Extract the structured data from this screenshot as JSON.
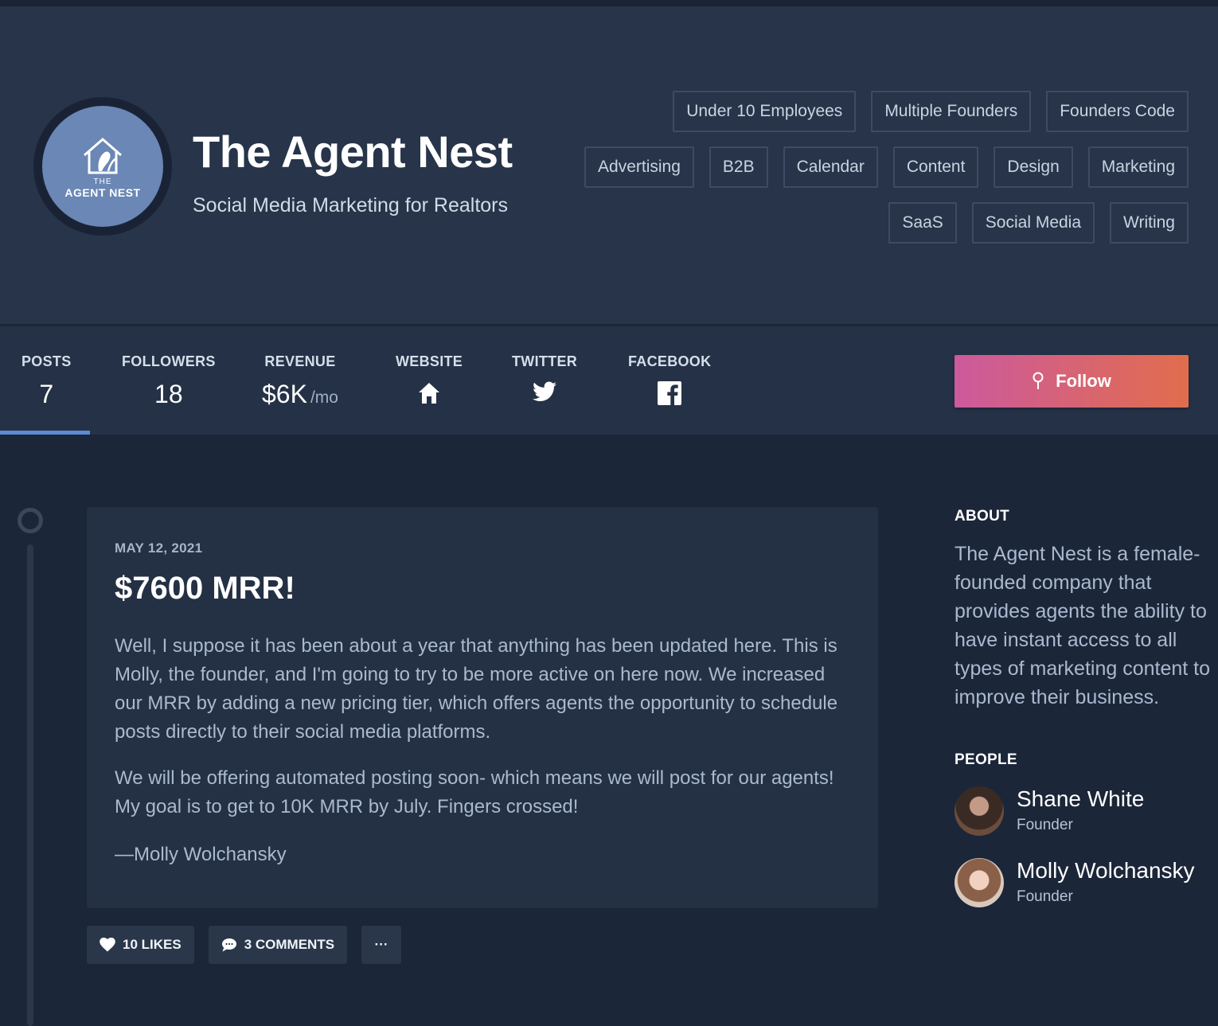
{
  "company": {
    "name": "The Agent Nest",
    "tagline": "Social Media Marketing for Realtors",
    "logo_text_top": "THE",
    "logo_text_main": "AGENT NEST"
  },
  "tags": {
    "row1": [
      "Under 10 Employees",
      "Multiple Founders",
      "Founders Code"
    ],
    "row2": [
      "Advertising",
      "B2B",
      "Calendar",
      "Content",
      "Design",
      "Marketing"
    ],
    "row3": [
      "SaaS",
      "Social Media",
      "Writing"
    ]
  },
  "stats": {
    "posts_label": "POSTS",
    "posts_value": "7",
    "followers_label": "FOLLOWERS",
    "followers_value": "18",
    "revenue_label": "REVENUE",
    "revenue_value": "$6K",
    "revenue_unit": "/mo",
    "website_label": "WEBSITE",
    "website_icon": "home-icon",
    "twitter_label": "TWITTER",
    "twitter_icon": "twitter-icon",
    "facebook_label": "FACEBOOK",
    "facebook_icon": "facebook-icon"
  },
  "follow_button": {
    "label": "Follow",
    "icon": "pin-icon"
  },
  "post": {
    "date": "MAY 12, 2021",
    "title": "$7600 MRR!",
    "paragraphs": [
      "Well, I suppose it has been about a year that anything has been updated here. This is Molly, the founder, and I'm going to try to be more active on here now. We increased our MRR by adding a new pricing tier, which offers agents the opportunity to schedule posts directly to their social media platforms.",
      "We will be offering automated posting soon- which means we will post for our agents! My goal is to get to 10K MRR by July. Fingers crossed!"
    ],
    "signature": "—Molly Wolchansky",
    "likes_label": "10 LIKES",
    "comments_label": "3 COMMENTS",
    "more_label": "···"
  },
  "sidebar": {
    "about_heading": "ABOUT",
    "about_text": "The Agent Nest is a female-founded company that provides agents the ability to have instant access to all types of marketing content to improve their business.",
    "people_heading": "PEOPLE",
    "people": [
      {
        "name": "Shane White",
        "role": "Founder"
      },
      {
        "name": "Molly Wolchansky",
        "role": "Founder"
      }
    ]
  },
  "colors": {
    "header_bg": "#273449",
    "page_bg": "#1c2639",
    "accent_blue": "#5b8bd3",
    "follow_gradient_start": "#cc5a9d",
    "follow_gradient_end": "#e16d4d"
  }
}
